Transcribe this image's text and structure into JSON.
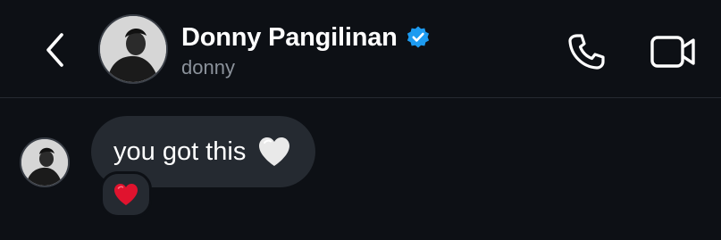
{
  "header": {
    "name": "Donny Pangilinan",
    "handle": "donny",
    "verified": true,
    "back_icon": "chevron-left-icon",
    "call_icon": "phone-icon",
    "video_icon": "video-camera-icon"
  },
  "messages": [
    {
      "text": "you got this",
      "emoji_icon": "white-heart-icon",
      "reaction_icon": "red-heart-icon"
    }
  ],
  "colors": {
    "background": "#0d1015",
    "bubble": "#252a31",
    "verified": "#1d9bf0",
    "handle": "#8b929b",
    "reaction_heart": "#e0132e"
  }
}
